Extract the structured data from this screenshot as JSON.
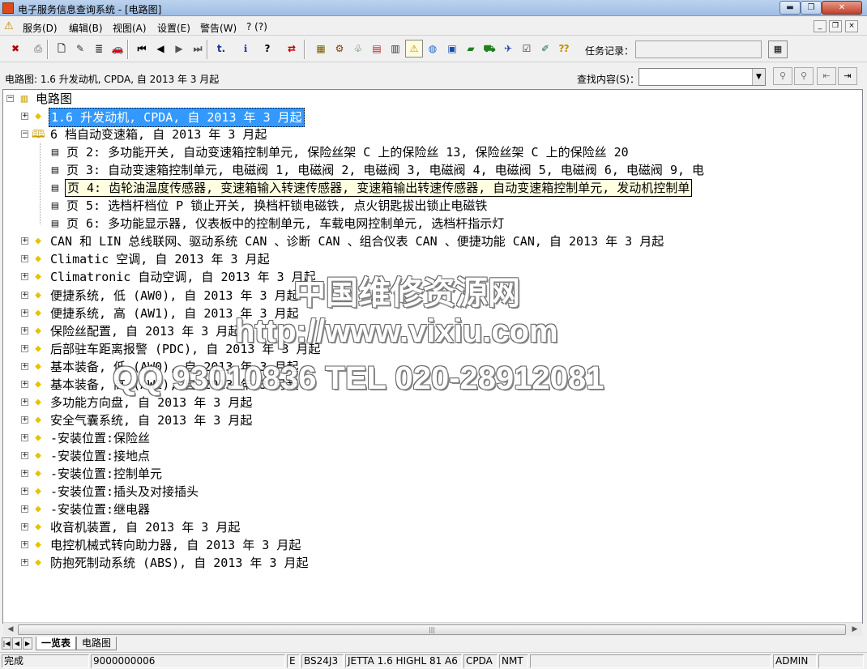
{
  "window": {
    "title": "电子服务信息查询系统 - [电路图]",
    "min_label": "▬",
    "max_label": "❐",
    "close_label": "✕"
  },
  "menu": {
    "items": [
      "服务(D)",
      "编辑(B)",
      "视图(A)",
      "设置(E)",
      "警告(W)",
      "? (?)"
    ],
    "mdi": [
      "_",
      "❐",
      "×"
    ]
  },
  "toolbar": {
    "buttons": [
      {
        "name": "clear-icon",
        "glyph": "✖",
        "color": "#b00000"
      },
      {
        "name": "print-icon",
        "glyph": "⎙",
        "color": "#999999"
      },
      {
        "name": "new-doc-icon",
        "glyph": "🗋",
        "color": "#333333"
      },
      {
        "name": "edit-doc-icon",
        "glyph": "✎",
        "color": "#333333"
      },
      {
        "name": "doc-list-icon",
        "glyph": "≣",
        "color": "#333333"
      },
      {
        "name": "car-icon",
        "glyph": "🚗",
        "color": "#333333"
      },
      {
        "name": "first-icon",
        "glyph": "⏮",
        "color": "#000000"
      },
      {
        "name": "prev-icon",
        "glyph": "◀",
        "color": "#000000"
      },
      {
        "name": "next-icon",
        "glyph": "▶",
        "color": "#555555"
      },
      {
        "name": "last-icon",
        "glyph": "⏭",
        "color": "#555555"
      },
      {
        "name": "jump-icon",
        "glyph": "t.",
        "color": "#1a3a9a"
      },
      {
        "name": "info-icon",
        "glyph": "ℹ",
        "color": "#1a3acc"
      },
      {
        "name": "help-icon",
        "glyph": "?",
        "color": "#000000"
      },
      {
        "name": "swap-icon",
        "glyph": "⇄",
        "color": "#c00000"
      },
      {
        "name": "module-icon",
        "glyph": "▦",
        "color": "#7a5a00"
      },
      {
        "name": "parts-icon",
        "glyph": "⚙",
        "color": "#7a3a00"
      },
      {
        "name": "tree-icon",
        "glyph": "♧",
        "color": "#206020"
      },
      {
        "name": "manual-icon",
        "glyph": "▤",
        "color": "#c02020"
      },
      {
        "name": "text-icon",
        "glyph": "▥",
        "color": "#333333"
      },
      {
        "name": "warning-icon",
        "glyph": "⚠",
        "color": "#c09000"
      },
      {
        "name": "globe-icon",
        "glyph": "◍",
        "color": "#1a6acc"
      },
      {
        "name": "save-icon",
        "glyph": "▣",
        "color": "#1a4aaa"
      },
      {
        "name": "green-book-icon",
        "glyph": "▰",
        "color": "#208020"
      },
      {
        "name": "vehicle-icon",
        "glyph": "⛟",
        "color": "#208020"
      },
      {
        "name": "diagnose-icon",
        "glyph": "✈",
        "color": "#1a3aaa"
      },
      {
        "name": "checklist-icon",
        "glyph": "☑",
        "color": "#333333"
      },
      {
        "name": "pen-book-icon",
        "glyph": "✐",
        "color": "#1a6a6a"
      },
      {
        "name": "question-book-icon",
        "glyph": "⁇",
        "color": "#c09000"
      }
    ],
    "task_label": "任务记录：",
    "task_button": "▦"
  },
  "info": {
    "path": "电路图: 1.6 升发动机, CPDA, 自 2013 年 3 月起",
    "find_label": "查找内容(S)：",
    "find_value": ""
  },
  "tree": {
    "root": "电路图",
    "nodes": [
      {
        "text": "1.6 升发动机, CPDA, 自 2013 年 3 月起",
        "state": "sel",
        "level": 1,
        "exp": "+"
      },
      {
        "text": "6 档自动变速箱, 自 2013 年 3 月起",
        "state": "",
        "level": 1,
        "exp": "−",
        "open": true
      },
      {
        "text": "页 2: 多功能开关, 自动变速箱控制单元, 保险丝架 C 上的保险丝 13, 保险丝架 C 上的保险丝 20",
        "state": "",
        "level": 2
      },
      {
        "text": "页 3: 自动变速箱控制单元, 电磁阀 1, 电磁阀 2, 电磁阀 3, 电磁阀 4, 电磁阀 5, 电磁阀 6, 电磁阀 9, 电",
        "state": "",
        "level": 2
      },
      {
        "text": "页 4: 齿轮油温度传感器, 变速箱输入转速传感器, 变速箱输出转速传感器, 自动变速箱控制单元, 发动机控制单",
        "state": "hov",
        "level": 2
      },
      {
        "text": "页 5: 选档杆档位 P 锁止开关, 换档杆锁电磁铁, 点火钥匙拔出锁止电磁铁",
        "state": "",
        "level": 2
      },
      {
        "text": "页 6: 多功能显示器, 仪表板中的控制单元, 车载电网控制单元, 选档杆指示灯",
        "state": "",
        "level": 2
      },
      {
        "text": "CAN 和 LIN 总线联网、驱动系统 CAN 、诊断 CAN 、组合仪表 CAN 、便捷功能 CAN, 自 2013 年 3 月起",
        "state": "",
        "level": 1,
        "exp": "+"
      },
      {
        "text": "Climatic 空调, 自 2013 年 3 月起",
        "state": "",
        "level": 1,
        "exp": "+"
      },
      {
        "text": "Climatronic 自动空调, 自 2013 年 3 月起",
        "state": "",
        "level": 1,
        "exp": "+"
      },
      {
        "text": "便捷系统, 低 (AW0), 自 2013 年 3 月起",
        "state": "",
        "level": 1,
        "exp": "+"
      },
      {
        "text": "便捷系统, 高 (AW1), 自 2013 年 3 月起",
        "state": "",
        "level": 1,
        "exp": "+"
      },
      {
        "text": "保险丝配置, 自 2013 年 3 月起",
        "state": "",
        "level": 1,
        "exp": "+"
      },
      {
        "text": "后部驻车距离报警 (PDC), 自 2013 年 3 月起",
        "state": "",
        "level": 1,
        "exp": "+"
      },
      {
        "text": "基本装备, 低 (AW0), 自 2013 年 3 月起",
        "state": "",
        "level": 1,
        "exp": "+"
      },
      {
        "text": "基本装备, 高 (AW1), 自 2013 年 3 月起",
        "state": "",
        "level": 1,
        "exp": "+"
      },
      {
        "text": "多功能方向盘, 自 2013 年 3 月起",
        "state": "",
        "level": 1,
        "exp": "+"
      },
      {
        "text": "安全气囊系统, 自 2013 年 3 月起",
        "state": "",
        "level": 1,
        "exp": "+"
      },
      {
        "text": "-安装位置:保险丝",
        "state": "",
        "level": 1,
        "exp": "+"
      },
      {
        "text": "-安装位置:接地点",
        "state": "",
        "level": 1,
        "exp": "+"
      },
      {
        "text": "-安装位置:控制单元",
        "state": "",
        "level": 1,
        "exp": "+"
      },
      {
        "text": "-安装位置:插头及对接插头",
        "state": "",
        "level": 1,
        "exp": "+"
      },
      {
        "text": "-安装位置:继电器",
        "state": "",
        "level": 1,
        "exp": "+"
      },
      {
        "text": "收音机装置, 自 2013 年 3 月起",
        "state": "",
        "level": 1,
        "exp": "+"
      },
      {
        "text": "电控机械式转向助力器, 自 2013 年 3 月起",
        "state": "",
        "level": 1,
        "exp": "+"
      },
      {
        "text": "防抱死制动系统 (ABS), 自 2013 年 3 月起",
        "state": "",
        "level": 1,
        "exp": "+"
      }
    ]
  },
  "watermark": {
    "line1": "中国维修资源网",
    "line2": "http://www.vixiu.com",
    "line3": "QQ 93010836  TEL 020-28912081"
  },
  "tabs": {
    "nav": [
      "|◀",
      "◀",
      "▶",
      "▶|"
    ],
    "items": [
      "一览表",
      "电路图"
    ],
    "active": 0
  },
  "status": {
    "panels": [
      "完成",
      "9000000006",
      "",
      "E",
      "BS24J3",
      "JETTA 1.6 HIGHL 81 A6",
      "CPDA",
      "NMT",
      "",
      "ADMIN",
      ""
    ]
  }
}
